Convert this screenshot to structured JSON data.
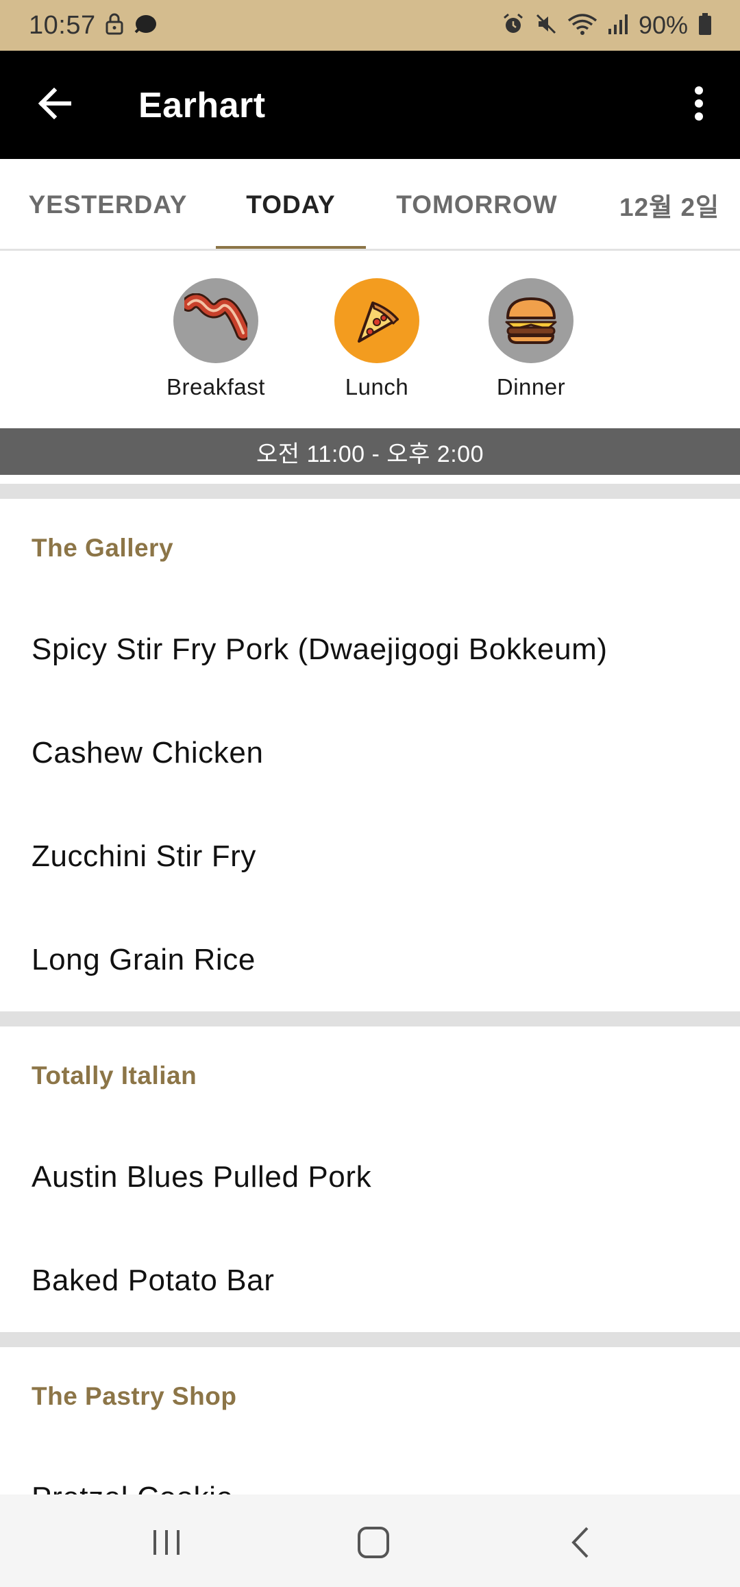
{
  "status_bar": {
    "time": "10:57",
    "battery": "90%"
  },
  "app_bar": {
    "title": "Earhart"
  },
  "tabs": [
    {
      "label": "YESTERDAY"
    },
    {
      "label": "TODAY",
      "active": true
    },
    {
      "label": "TOMORROW"
    },
    {
      "label": "12월 2일"
    }
  ],
  "meals": [
    {
      "label": "Breakfast",
      "icon": "bacon-icon"
    },
    {
      "label": "Lunch",
      "icon": "pizza-icon",
      "active": true
    },
    {
      "label": "Dinner",
      "icon": "burger-icon"
    }
  ],
  "time_range": "오전 11:00 - 오후 2:00",
  "sections": [
    {
      "title": "The Gallery",
      "items": [
        "Spicy Stir Fry Pork (Dwaejigogi Bokkeum)",
        "Cashew Chicken",
        "Zucchini Stir Fry",
        "Long Grain Rice"
      ]
    },
    {
      "title": "Totally Italian",
      "items": [
        "Austin Blues Pulled Pork",
        "Baked Potato Bar"
      ]
    },
    {
      "title": "The Pastry Shop",
      "items": [
        "Pretzel Cookie"
      ]
    }
  ],
  "colors": {
    "status_bar": "#d4bc8e",
    "accent": "#8c7547",
    "active_meal": "#f39c1f",
    "inactive_meal": "#9e9e9e",
    "time_banner": "#616161"
  }
}
